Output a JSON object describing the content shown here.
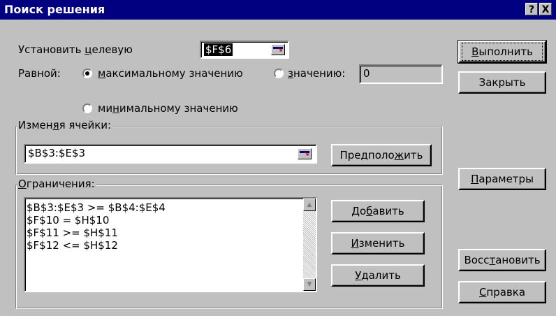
{
  "window": {
    "title": "Поиск решения",
    "help_btn": "?",
    "close_btn": "X"
  },
  "target": {
    "label": "Установить целевую",
    "value": "$F$6"
  },
  "equal": {
    "label": "Равной:",
    "option_max": "максимальному значению",
    "option_value": "значению:",
    "value_field": "0",
    "option_min": "минимальному значению",
    "selected": "max"
  },
  "changing": {
    "label": "Изменяя ячейки:",
    "value": "$B$3:$E$3",
    "guess_button": "Предположить"
  },
  "constraints": {
    "label": "Ограничения:",
    "items": [
      "$B$3:$E$3 >= $B$4:$E$4",
      "$F$10 = $H$10",
      "$F$11 >= $H$11",
      "$F$12 <= $H$12"
    ],
    "add_button": "Добавить",
    "change_button": "Изменить",
    "delete_button": "Удалить"
  },
  "side_buttons": {
    "solve": "Выполнить",
    "close": "Закрыть",
    "options": "Параметры",
    "reset": "Восстановить",
    "help": "Справка"
  }
}
